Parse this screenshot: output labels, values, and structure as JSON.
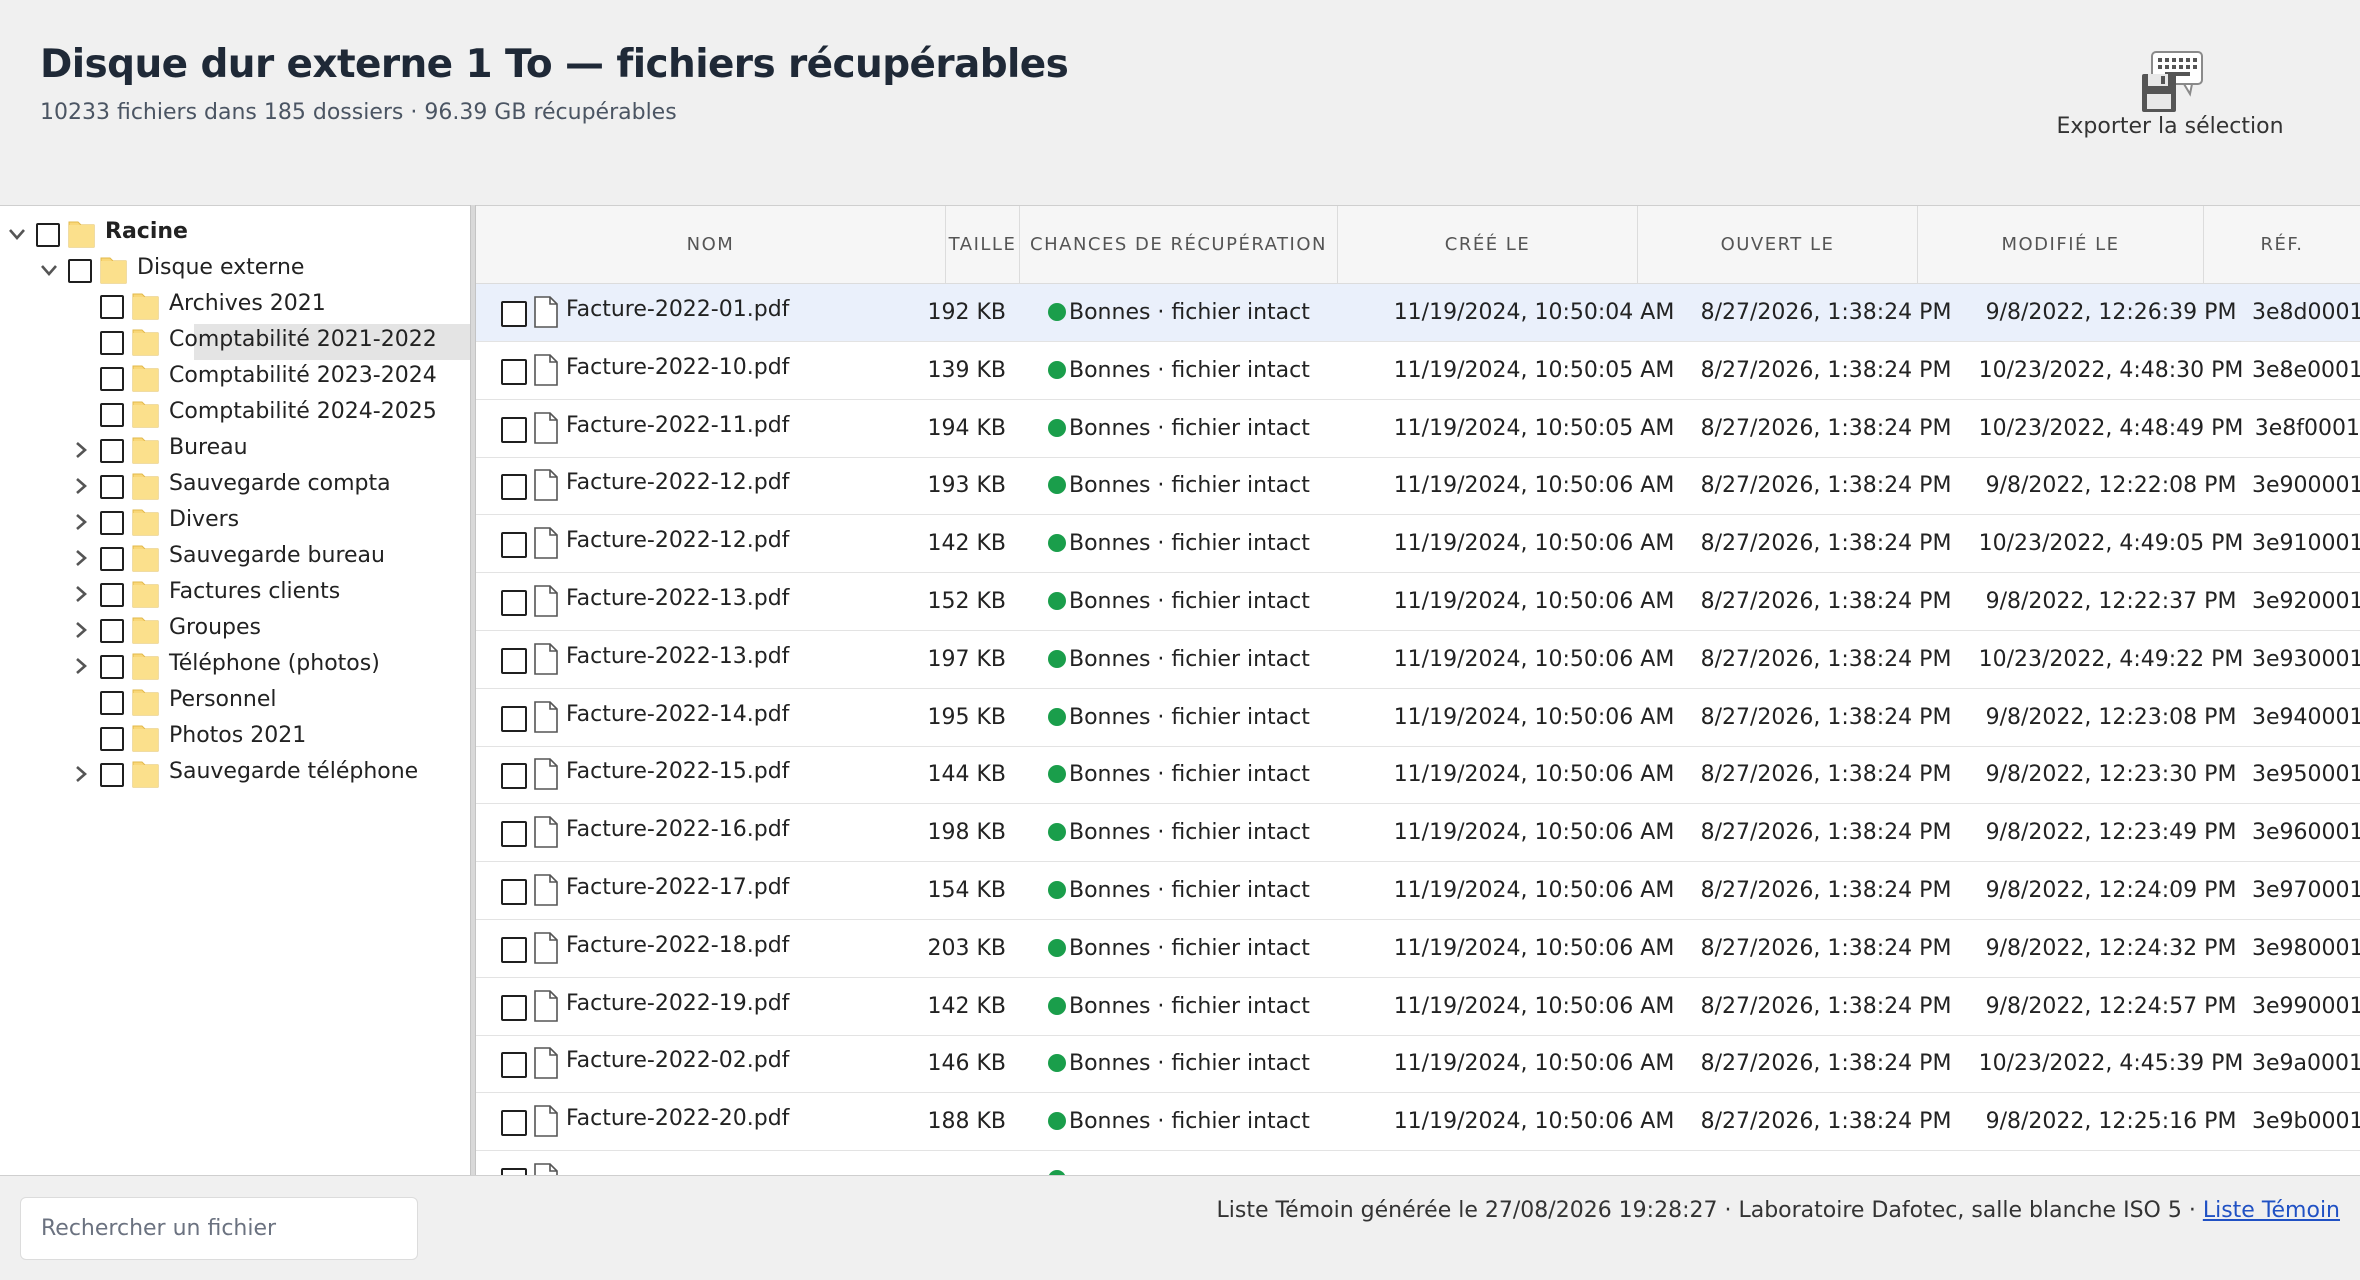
{
  "header": {
    "title": "Disque dur externe 1 To — fichiers récupérables",
    "subtitle": "10233 fichiers dans 185 dossiers · 96.39 GB récupérables",
    "export_label": "Exporter la sélection",
    "export_icon": "floppy-save-keyboard-icon"
  },
  "tree": {
    "items": [
      {
        "label": "Racine",
        "level": 0,
        "expandable": true,
        "expanded": true,
        "bold": true
      },
      {
        "label": "Disque externe",
        "level": 1,
        "expandable": true,
        "expanded": true
      },
      {
        "label": "Archives 2021",
        "level": 2,
        "expandable": false
      },
      {
        "label": "Comptabilité 2021-2022",
        "level": 2,
        "expandable": false,
        "selected": true
      },
      {
        "label": "Comptabilité 2023-2024",
        "level": 2,
        "expandable": false
      },
      {
        "label": "Comptabilité 2024-2025",
        "level": 2,
        "expandable": false
      },
      {
        "label": "Bureau",
        "level": 2,
        "expandable": true,
        "expanded": false
      },
      {
        "label": "Sauvegarde compta",
        "level": 2,
        "expandable": true,
        "expanded": false
      },
      {
        "label": "Divers",
        "level": 2,
        "expandable": true,
        "expanded": false
      },
      {
        "label": "Sauvegarde bureau",
        "level": 2,
        "expandable": true,
        "expanded": false
      },
      {
        "label": "Factures clients",
        "level": 2,
        "expandable": true,
        "expanded": false
      },
      {
        "label": "Groupes",
        "level": 2,
        "expandable": true,
        "expanded": false
      },
      {
        "label": "Téléphone (photos)",
        "level": 2,
        "expandable": true,
        "expanded": false
      },
      {
        "label": "Personnel",
        "level": 2,
        "expandable": false
      },
      {
        "label": "Photos 2021",
        "level": 2,
        "expandable": false
      },
      {
        "label": "Sauvegarde téléphone",
        "level": 2,
        "expandable": true,
        "expanded": false
      }
    ]
  },
  "table": {
    "columns": {
      "name": "NOM",
      "size": "TAILLE",
      "chance": "CHANCES DE RÉCUPÉRATION",
      "created": "CRÉÉ LE",
      "opened": "OUVERT LE",
      "modified": "MODIFIÉ LE",
      "ref": "RÉF."
    },
    "status_color": "#1a9e4b",
    "rows": [
      {
        "name": "Facture-2022-01.pdf",
        "size": "192 KB",
        "chance": "Bonnes · fichier intact",
        "created": "11/19/2024, 10:50:04 AM",
        "opened": "8/27/2026, 1:38:24 PM",
        "modified": "9/8/2022, 12:26:39 PM",
        "ref": "3e8d0001"
      },
      {
        "name": "Facture-2022-10.pdf",
        "size": "139 KB",
        "chance": "Bonnes · fichier intact",
        "created": "11/19/2024, 10:50:05 AM",
        "opened": "8/27/2026, 1:38:24 PM",
        "modified": "10/23/2022, 4:48:30 PM",
        "ref": "3e8e0001"
      },
      {
        "name": "Facture-2022-11.pdf",
        "size": "194 KB",
        "chance": "Bonnes · fichier intact",
        "created": "11/19/2024, 10:50:05 AM",
        "opened": "8/27/2026, 1:38:24 PM",
        "modified": "10/23/2022, 4:48:49 PM",
        "ref": "3e8f0001"
      },
      {
        "name": "Facture-2022-12.pdf",
        "size": "193 KB",
        "chance": "Bonnes · fichier intact",
        "created": "11/19/2024, 10:50:06 AM",
        "opened": "8/27/2026, 1:38:24 PM",
        "modified": "9/8/2022, 12:22:08 PM",
        "ref": "3e900001"
      },
      {
        "name": "Facture-2022-12.pdf",
        "size": "142 KB",
        "chance": "Bonnes · fichier intact",
        "created": "11/19/2024, 10:50:06 AM",
        "opened": "8/27/2026, 1:38:24 PM",
        "modified": "10/23/2022, 4:49:05 PM",
        "ref": "3e910001"
      },
      {
        "name": "Facture-2022-13.pdf",
        "size": "152 KB",
        "chance": "Bonnes · fichier intact",
        "created": "11/19/2024, 10:50:06 AM",
        "opened": "8/27/2026, 1:38:24 PM",
        "modified": "9/8/2022, 12:22:37 PM",
        "ref": "3e920001"
      },
      {
        "name": "Facture-2022-13.pdf",
        "size": "197 KB",
        "chance": "Bonnes · fichier intact",
        "created": "11/19/2024, 10:50:06 AM",
        "opened": "8/27/2026, 1:38:24 PM",
        "modified": "10/23/2022, 4:49:22 PM",
        "ref": "3e930001"
      },
      {
        "name": "Facture-2022-14.pdf",
        "size": "195 KB",
        "chance": "Bonnes · fichier intact",
        "created": "11/19/2024, 10:50:06 AM",
        "opened": "8/27/2026, 1:38:24 PM",
        "modified": "9/8/2022, 12:23:08 PM",
        "ref": "3e940001"
      },
      {
        "name": "Facture-2022-15.pdf",
        "size": "144 KB",
        "chance": "Bonnes · fichier intact",
        "created": "11/19/2024, 10:50:06 AM",
        "opened": "8/27/2026, 1:38:24 PM",
        "modified": "9/8/2022, 12:23:30 PM",
        "ref": "3e950001"
      },
      {
        "name": "Facture-2022-16.pdf",
        "size": "198 KB",
        "chance": "Bonnes · fichier intact",
        "created": "11/19/2024, 10:50:06 AM",
        "opened": "8/27/2026, 1:38:24 PM",
        "modified": "9/8/2022, 12:23:49 PM",
        "ref": "3e960001"
      },
      {
        "name": "Facture-2022-17.pdf",
        "size": "154 KB",
        "chance": "Bonnes · fichier intact",
        "created": "11/19/2024, 10:50:06 AM",
        "opened": "8/27/2026, 1:38:24 PM",
        "modified": "9/8/2022, 12:24:09 PM",
        "ref": "3e970001"
      },
      {
        "name": "Facture-2022-18.pdf",
        "size": "203 KB",
        "chance": "Bonnes · fichier intact",
        "created": "11/19/2024, 10:50:06 AM",
        "opened": "8/27/2026, 1:38:24 PM",
        "modified": "9/8/2022, 12:24:32 PM",
        "ref": "3e980001"
      },
      {
        "name": "Facture-2022-19.pdf",
        "size": "142 KB",
        "chance": "Bonnes · fichier intact",
        "created": "11/19/2024, 10:50:06 AM",
        "opened": "8/27/2026, 1:38:24 PM",
        "modified": "9/8/2022, 12:24:57 PM",
        "ref": "3e990001"
      },
      {
        "name": "Facture-2022-02.pdf",
        "size": "146 KB",
        "chance": "Bonnes · fichier intact",
        "created": "11/19/2024, 10:50:06 AM",
        "opened": "8/27/2026, 1:38:24 PM",
        "modified": "10/23/2022, 4:45:39 PM",
        "ref": "3e9a0001"
      },
      {
        "name": "Facture-2022-20.pdf",
        "size": "188 KB",
        "chance": "Bonnes · fichier intact",
        "created": "11/19/2024, 10:50:06 AM",
        "opened": "8/27/2026, 1:38:24 PM",
        "modified": "9/8/2022, 12:25:16 PM",
        "ref": "3e9b0001"
      }
    ]
  },
  "footer": {
    "search_placeholder": "Rechercher un fichier",
    "note": "Liste Témoin générée le 27/08/2026 19:28:27 · Laboratoire Dafotec, salle blanche ISO 5 · ",
    "link": "Liste Témoin"
  }
}
